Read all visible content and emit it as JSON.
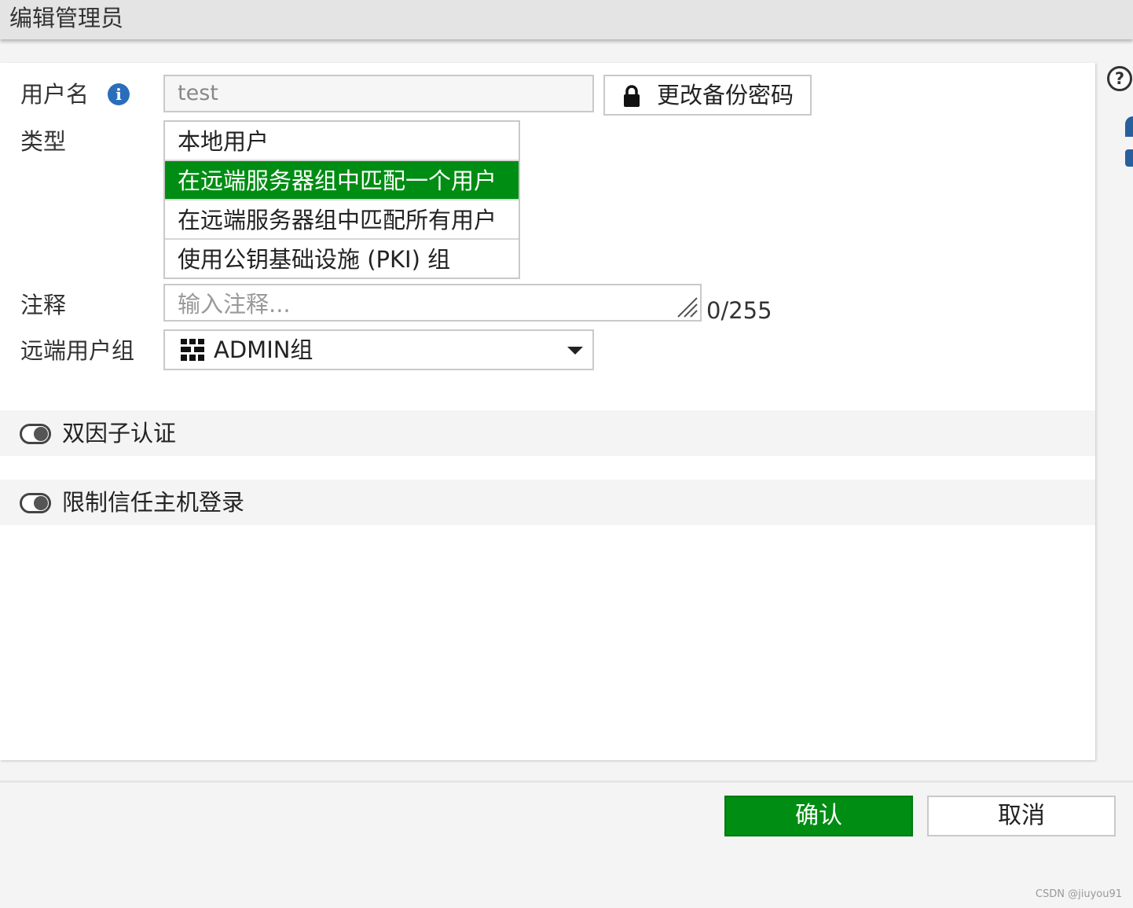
{
  "dialog": {
    "title": "编辑管理员"
  },
  "form": {
    "username_label": "用户名",
    "username_value": "test",
    "change_password_label": "更改备份密码",
    "type_label": "类型",
    "type_options": [
      {
        "label": "本地用户",
        "selected": false
      },
      {
        "label": "在远端服务器组中匹配一个用户",
        "selected": true
      },
      {
        "label": "在远端服务器组中匹配所有用户",
        "selected": false
      },
      {
        "label": "使用公钥基础设施 (PKI) 组",
        "selected": false
      }
    ],
    "comment_label": "注释",
    "comment_placeholder": "输入注释...",
    "comment_counter": "0/255",
    "remote_group_label": "远端用户组",
    "remote_group_value": "ADMIN组"
  },
  "toggles": {
    "two_factor": {
      "label": "双因子认证",
      "enabled": false
    },
    "trusted_hosts": {
      "label": "限制信任主机登录",
      "enabled": false
    }
  },
  "footer": {
    "ok_label": "确认",
    "cancel_label": "取消"
  },
  "watermark": "CSDN @jiuyou91",
  "colors": {
    "accent_green": "#008d13",
    "info_blue": "#2a6ebb"
  },
  "icons": {
    "info": "info-icon",
    "lock": "lock-icon",
    "group": "user-group-icon",
    "dropdown": "chevron-down-icon",
    "help": "help-icon"
  }
}
